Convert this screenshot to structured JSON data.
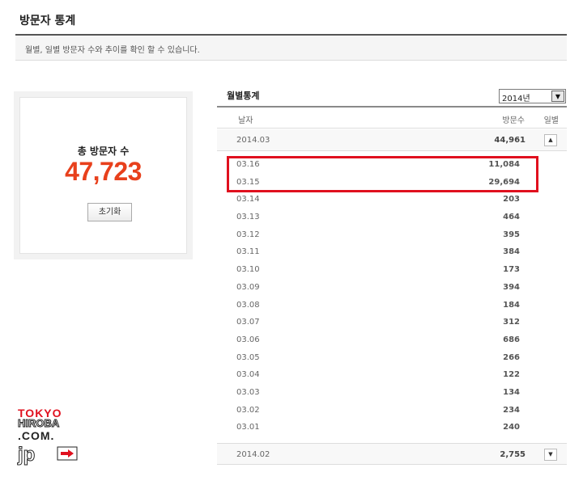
{
  "header": {
    "title": "방문자 통계",
    "description": "월별, 일별 방문자 수와 추이를 확인 할 수 있습니다."
  },
  "summary": {
    "total_label": "총 방문자 수",
    "total_value": "47,723",
    "reset_label": "초기화"
  },
  "monthly": {
    "title": "월별통계",
    "year_selected": "2014년",
    "columns": {
      "date": "날자",
      "visits": "방문수",
      "daily": "일별"
    },
    "current_month": {
      "date": "2014.03",
      "count": "44,961",
      "toggle": "▲"
    },
    "days": [
      {
        "date": "03.16",
        "count": "11,084"
      },
      {
        "date": "03.15",
        "count": "29,694"
      },
      {
        "date": "03.14",
        "count": "203"
      },
      {
        "date": "03.13",
        "count": "464"
      },
      {
        "date": "03.12",
        "count": "395"
      },
      {
        "date": "03.11",
        "count": "384"
      },
      {
        "date": "03.10",
        "count": "173"
      },
      {
        "date": "03.09",
        "count": "394"
      },
      {
        "date": "03.08",
        "count": "184"
      },
      {
        "date": "03.07",
        "count": "312"
      },
      {
        "date": "03.06",
        "count": "686"
      },
      {
        "date": "03.05",
        "count": "266"
      },
      {
        "date": "03.04",
        "count": "122"
      },
      {
        "date": "03.03",
        "count": "134"
      },
      {
        "date": "03.02",
        "count": "234"
      },
      {
        "date": "03.01",
        "count": "240"
      }
    ],
    "previous_month": {
      "date": "2014.02",
      "count": "2,755",
      "toggle": "▼"
    }
  },
  "watermark": {
    "line1": "TOKYO",
    "line2": "HIROBA",
    "line3": ".COM.",
    "line4": "jp",
    "icon": "right-arrow-icon"
  },
  "colors": {
    "accent": "#e8401c",
    "highlight_border": "#e0101e"
  }
}
